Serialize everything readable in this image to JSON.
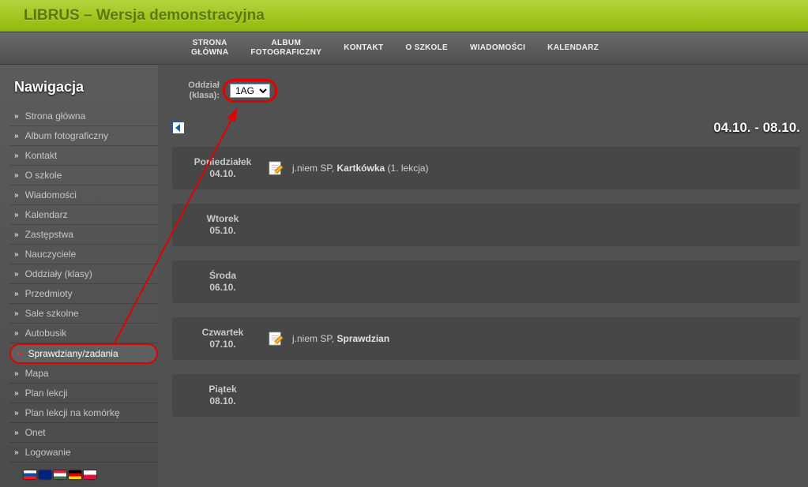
{
  "app": {
    "title": "LIBRUS – Wersja demonstracyjna"
  },
  "topnav": {
    "items": [
      "STRONA\nGŁÓWNA",
      "ALBUM\nFOTOGRAFICZNY",
      "KONTAKT",
      "O SZKOLE",
      "WIADOMOŚCI",
      "KALENDARZ"
    ]
  },
  "sidebar": {
    "title": "Nawigacja",
    "items": [
      "Strona główna",
      "Album fotograficzny",
      "Kontakt",
      "O szkole",
      "Wiadomości",
      "Kalendarz",
      "Zastępstwa",
      "Nauczyciele",
      "Oddziały (klasy)",
      "Przedmioty",
      "Sale szkolne",
      "Autobusik",
      "Sprawdziany/zadania",
      "Mapa",
      "Plan lekcji",
      "Plan lekcji na komórkę",
      "Onet",
      "Logowanie"
    ],
    "active_index": 12
  },
  "class_select": {
    "label": "Oddział (klasa):",
    "value": "1AG"
  },
  "date_range": "04.10. - 08.10.",
  "days": [
    {
      "name": "Poniedziałek",
      "date": "04.10.",
      "event": {
        "subject": "j.niem SP",
        "type": "Kartkówka",
        "extra": "(1. lekcja)",
        "has_icon": true
      }
    },
    {
      "name": "Wtorek",
      "date": "05.10.",
      "event": null
    },
    {
      "name": "Środa",
      "date": "06.10.",
      "event": null
    },
    {
      "name": "Czwartek",
      "date": "07.10.",
      "event": {
        "subject": "j.niem SP",
        "type": "Sprawdzian",
        "extra": "",
        "has_icon": true
      }
    },
    {
      "name": "Piątek",
      "date": "08.10.",
      "event": null
    }
  ]
}
